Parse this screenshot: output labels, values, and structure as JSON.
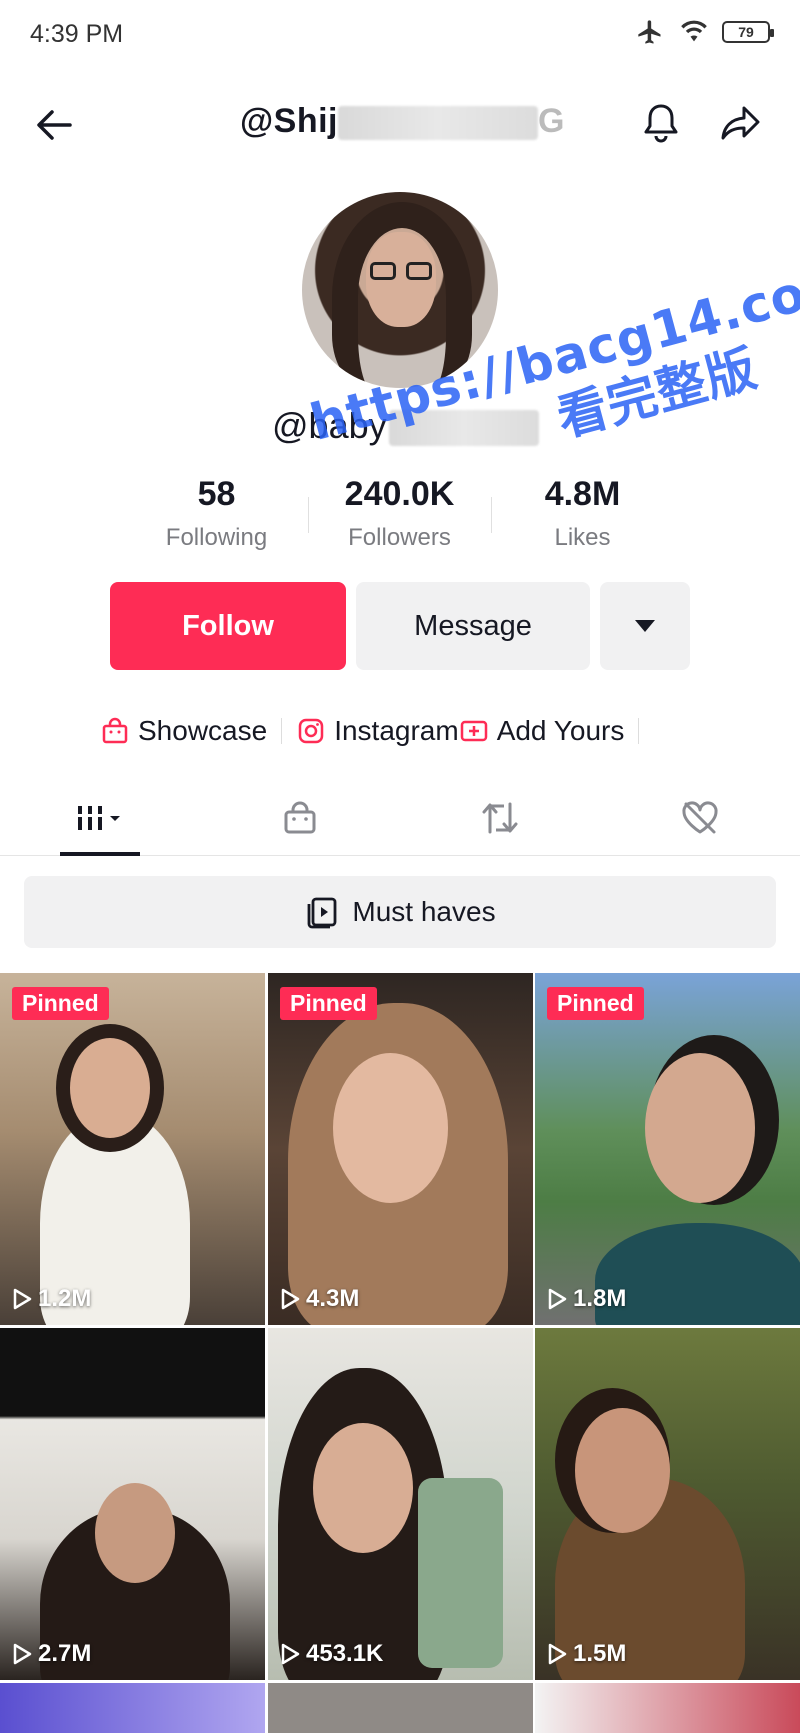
{
  "status_bar": {
    "time": "4:39 PM",
    "battery": "79"
  },
  "header": {
    "title_visible": "@Shij",
    "title_end": "G"
  },
  "profile": {
    "username_visible": "@baby",
    "stats": [
      {
        "value": "58",
        "label": "Following"
      },
      {
        "value": "240.0K",
        "label": "Followers"
      },
      {
        "value": "4.8M",
        "label": "Likes"
      }
    ]
  },
  "watermark": {
    "line1": "https://bacg14.com",
    "line2": "看完整版"
  },
  "actions": {
    "follow": "Follow",
    "message": "Message"
  },
  "links": [
    {
      "label": "Showcase",
      "icon": "shopping-bag-icon"
    },
    {
      "label": "Instagram",
      "icon": "instagram-icon"
    },
    {
      "label": "Add Yours",
      "icon": "add-yours-icon"
    }
  ],
  "tabs": [
    {
      "name": "videos",
      "icon": "grid-icon",
      "active": true
    },
    {
      "name": "showcase",
      "icon": "shopping-bag-icon",
      "active": false
    },
    {
      "name": "reposts",
      "icon": "repost-icon",
      "active": false
    },
    {
      "name": "liked",
      "icon": "heart-hidden-icon",
      "active": false
    }
  ],
  "playlist": {
    "label": "Must haves"
  },
  "videos": [
    {
      "pinned": "Pinned",
      "views": "1.2M"
    },
    {
      "pinned": "Pinned",
      "views": "4.3M"
    },
    {
      "pinned": "Pinned",
      "views": "1.8M"
    },
    {
      "pinned": "",
      "views": "2.7M"
    },
    {
      "pinned": "",
      "views": "453.1K"
    },
    {
      "pinned": "",
      "views": "1.5M"
    }
  ],
  "colors": {
    "accent": "#fe2c55",
    "watermark": "#2b63f5",
    "button_bg": "#f1f1f2"
  }
}
